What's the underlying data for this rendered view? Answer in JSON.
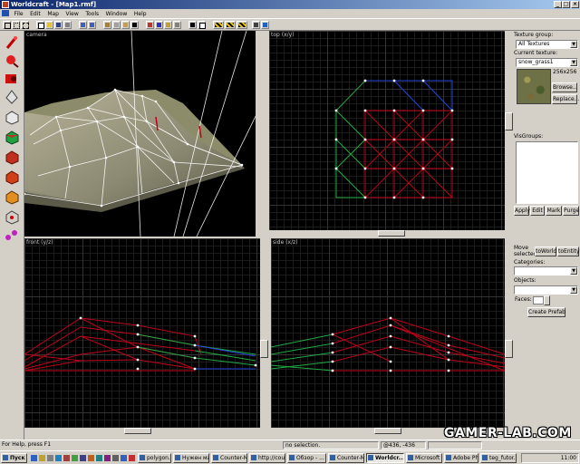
{
  "window": {
    "title": "Worldcraft - [Map1.rmf]"
  },
  "menu": [
    "File",
    "Edit",
    "Map",
    "View",
    "Tools",
    "Window",
    "Help"
  ],
  "viewports": {
    "camera": "camera",
    "top": "top (x/y)",
    "front": "front (y/z)",
    "side": "side (x/z)"
  },
  "texture": {
    "group_label": "Texture group:",
    "group_value": "All Textures",
    "current_label": "Current texture:",
    "current_value": "snow_grass1",
    "size": "256x256",
    "browse": "Browse...",
    "replace": "Replace..."
  },
  "visgroups": {
    "label": "VisGroups:",
    "apply": "Apply",
    "edit": "Edit",
    "mark": "Mark",
    "purge": "Purge"
  },
  "move_selected": {
    "label": "Move selected:",
    "to_world": "toWorld",
    "to_entity": "toEntity"
  },
  "categories_label": "Categories:",
  "objects_label": "Objects:",
  "faces_label": "Faces:",
  "create_prefab": "Create Prefab",
  "status": {
    "help": "For Help, press F1",
    "selection": "no selection.",
    "coords": "@436, -436"
  },
  "taskbar": {
    "start": "Пуск",
    "items": [
      "polygon.co...",
      "Нужен ма...",
      "Counter-M...",
      "http://cou...",
      "Обзор - ...",
      "Counter-M...",
      "Worldcr...",
      "Microsoft ...",
      "Adobe Ph...",
      "teg_futor..."
    ],
    "clock": "11:00"
  },
  "watermark": "GAMER-LAB.COM",
  "colors": {
    "brush_red": "#c00018",
    "brush_green": "#22aa44",
    "brush_blue": "#2244dd",
    "vertex": "#ffffff",
    "title_bar": "#0a246a"
  }
}
